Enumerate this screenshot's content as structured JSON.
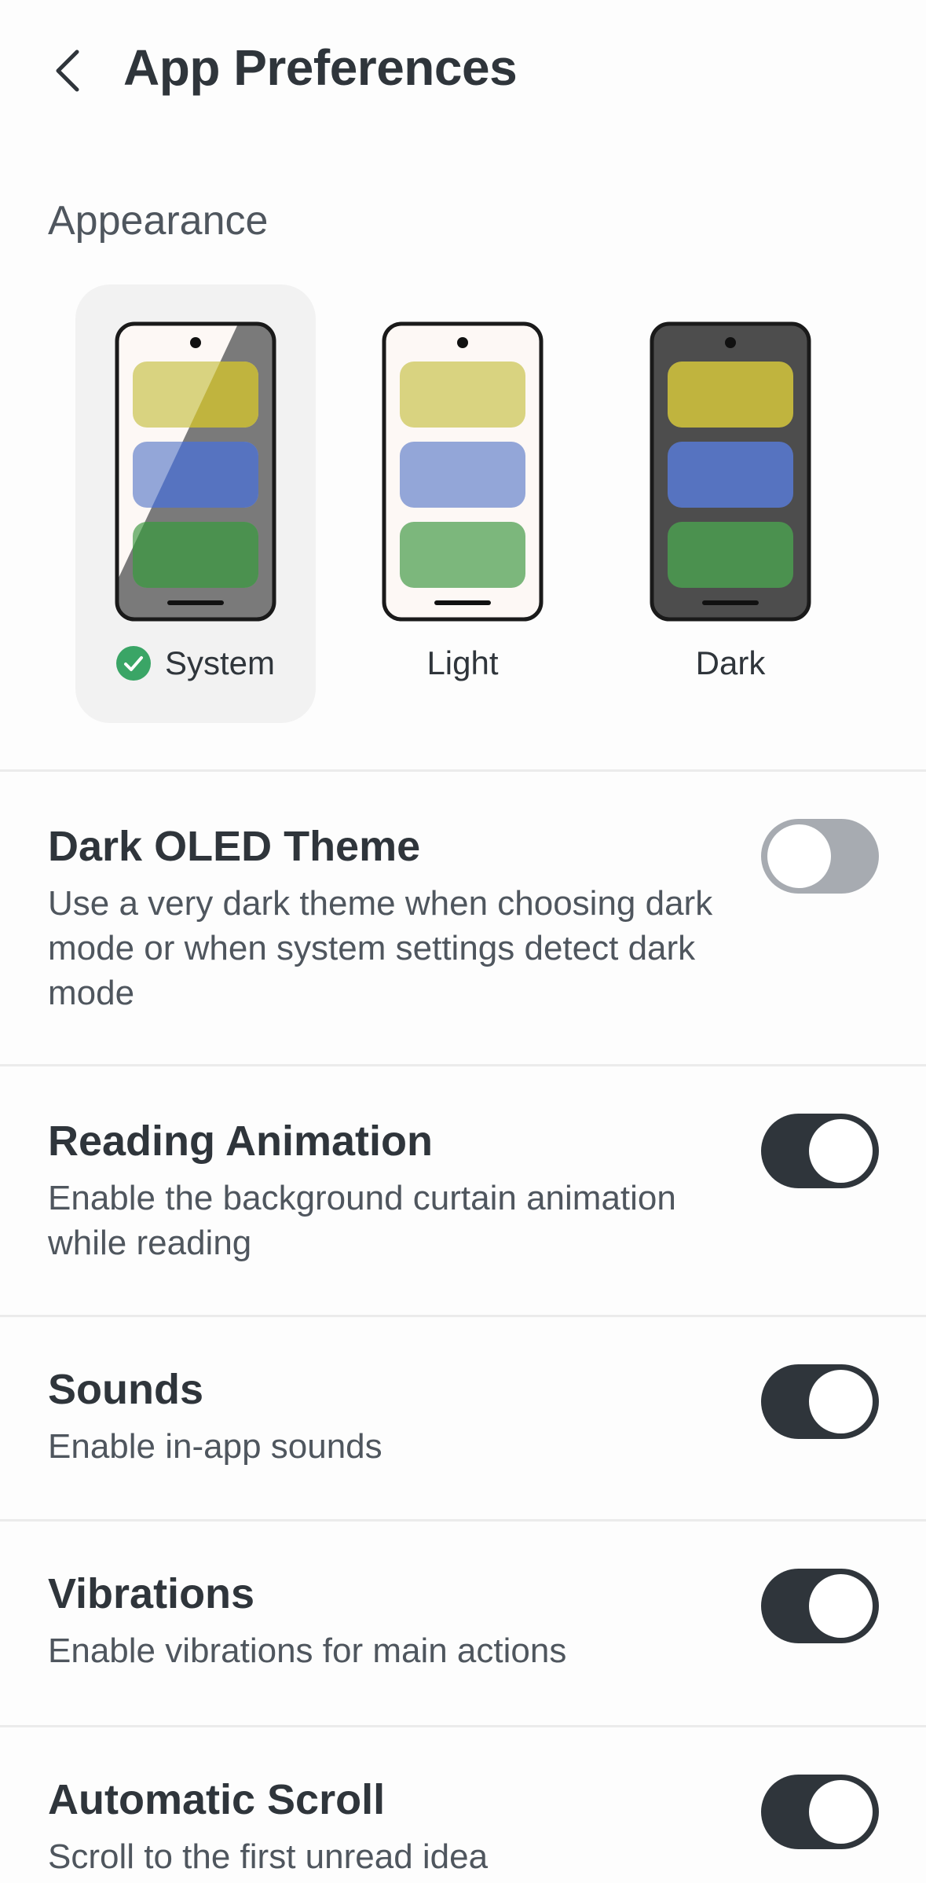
{
  "header": {
    "title": "App Preferences",
    "back_icon": "chevron-left-icon"
  },
  "appearance": {
    "section_title": "Appearance",
    "options": [
      {
        "label": "System",
        "selected": true
      },
      {
        "label": "Light",
        "selected": false
      },
      {
        "label": "Dark",
        "selected": false
      }
    ],
    "selected_icon": "check-circle-icon",
    "colors": {
      "yellow_light": "#d9d380",
      "yellow_dark": "#c0b43e",
      "blue_light": "#93a6d8",
      "blue_dark": "#5673c0",
      "green_light": "#7cb77c",
      "green_dark": "#4b914f",
      "check_green": "#3aa566"
    }
  },
  "settings": [
    {
      "title": "Dark OLED Theme",
      "description": "Use a very dark theme when choosing dark mode or when system settings detect dark mode",
      "enabled": false
    },
    {
      "title": "Reading Animation",
      "description": "Enable the background curtain animation while reading",
      "enabled": true
    },
    {
      "title": "Sounds",
      "description": "Enable in-app sounds",
      "enabled": true
    },
    {
      "title": "Vibrations",
      "description": "Enable vibrations for main actions",
      "enabled": true
    },
    {
      "title": "Automatic Scroll",
      "description": "Scroll to the first unread idea",
      "enabled": true
    }
  ]
}
